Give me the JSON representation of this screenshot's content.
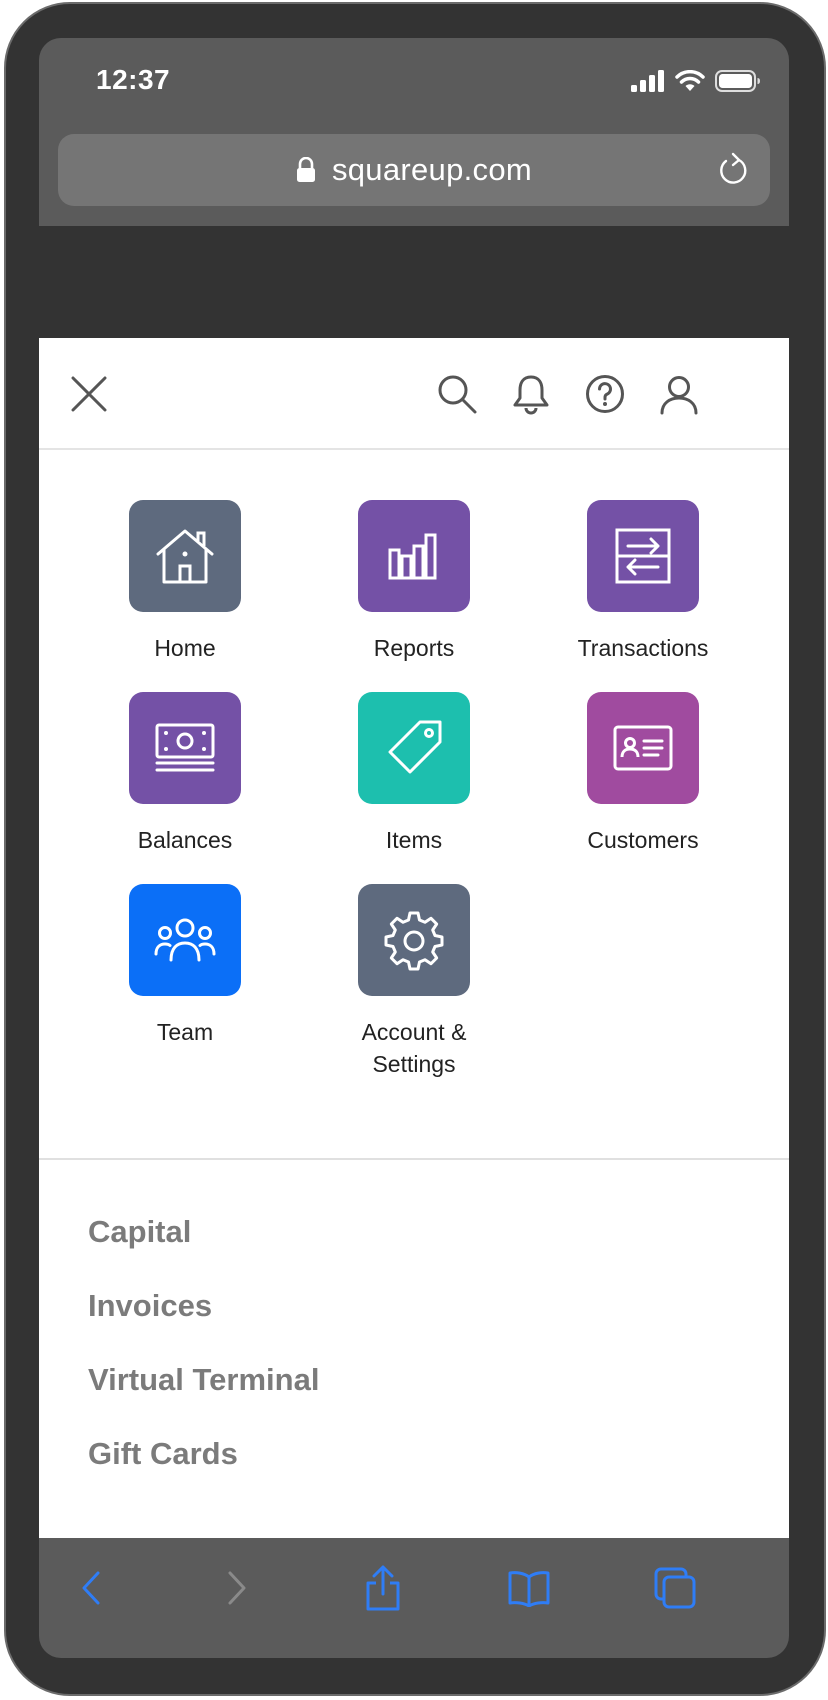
{
  "status_bar": {
    "time": "12:37"
  },
  "browser": {
    "url": "squareup.com",
    "icons": [
      "lock-icon",
      "reload-icon",
      "back-icon",
      "forward-icon",
      "share-icon",
      "bookmarks-icon",
      "tabs-icon"
    ],
    "accent_color": "#2f7df6"
  },
  "header": {
    "icons": [
      "close-icon",
      "search-icon",
      "bell-icon",
      "help-icon",
      "profile-icon"
    ]
  },
  "apps": [
    {
      "label": "Home",
      "icon": "house-icon",
      "color": "#5e6a7e"
    },
    {
      "label": "Reports",
      "icon": "bar-chart-icon",
      "color": "#7451a6"
    },
    {
      "label": "Transactions",
      "icon": "transfer-icon",
      "color": "#7451a6"
    },
    {
      "label": "Balances",
      "icon": "cash-icon",
      "color": "#7451a6"
    },
    {
      "label": "Items",
      "icon": "tag-icon",
      "color": "#1dbfae"
    },
    {
      "label": "Customers",
      "icon": "contact-card-icon",
      "color": "#a04b9f"
    },
    {
      "label": "Team",
      "icon": "team-icon",
      "color": "#0b6ff7"
    },
    {
      "label": "Account &\nSettings",
      "icon": "gear-icon",
      "color": "#5e6a7e"
    }
  ],
  "links": [
    "Capital",
    "Invoices",
    "Virtual Terminal",
    "Gift Cards"
  ]
}
